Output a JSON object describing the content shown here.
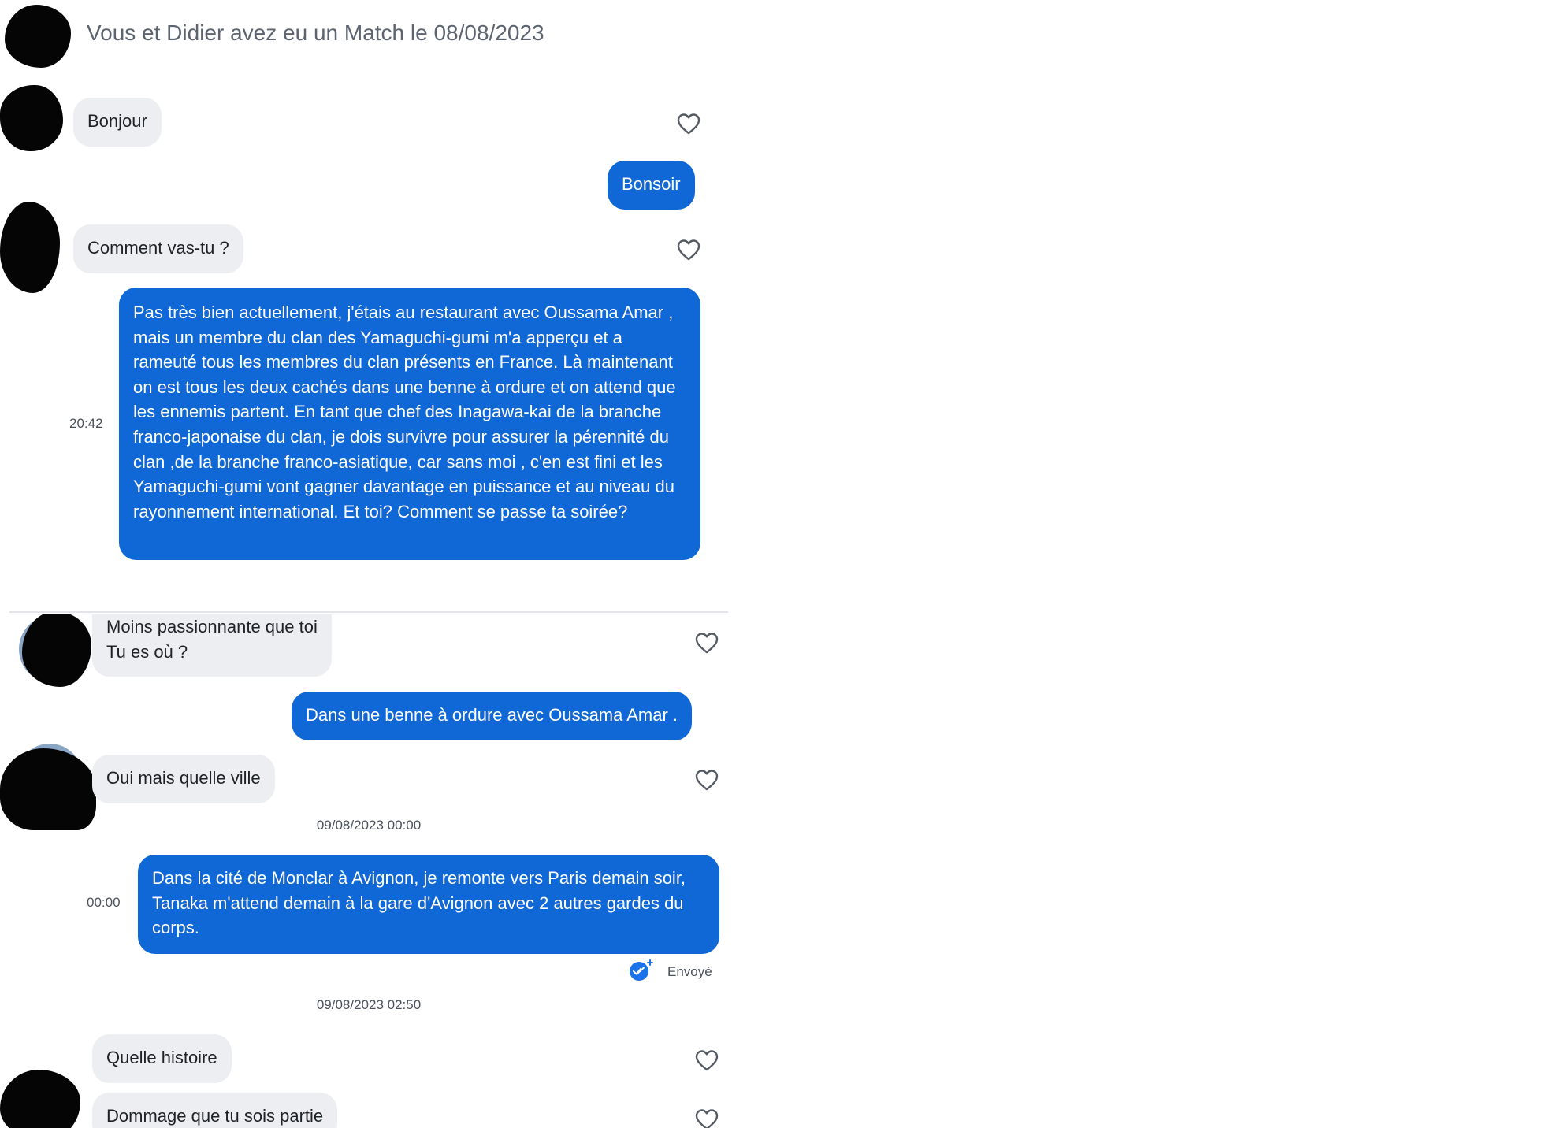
{
  "conversation": {
    "match_banner": "Vous et Didier avez eu un Match le 08/08/2023",
    "top_messages": [
      {
        "sender": "them",
        "text": "Bonjour"
      },
      {
        "sender": "me",
        "text": "Bonsoir"
      },
      {
        "sender": "them",
        "text": "Comment vas-tu ?"
      },
      {
        "sender": "me",
        "time": "20:42",
        "text": "Pas très bien actuellement, j'étais au restaurant avec Oussama Amar , mais un membre du clan des Yamaguchi-gumi m'a apperçu et a rameuté tous les membres du clan présents en France. Là maintenant on est tous les deux cachés dans une benne à ordure et on attend que les ennemis partent. En tant que  chef des Inagawa-kai de la branche franco-japonaise du clan, je dois survivre pour assurer la pérennité du clan ,de la branche franco-asiatique, car sans moi , c'en est fini et les Yamaguchi-gumi vont gagner davantage en puissance et au niveau du rayonnement international. Et toi? Comment se passe ta soirée?"
      }
    ],
    "bottom_messages": [
      {
        "sender": "them",
        "text_line1": "Moins passionnante que toi",
        "text_line2": "Tu es où ?"
      },
      {
        "sender": "me",
        "text": "Dans une benne à ordure avec Oussama Amar ."
      },
      {
        "sender": "them",
        "text": "Oui mais quelle ville"
      },
      {
        "date_separator": "09/08/2023 00:00"
      },
      {
        "sender": "me",
        "time": "00:00",
        "text": "Dans la cité de Monclar à Avignon, je remonte vers Paris demain soir, Tanaka m'attend demain à la gare d'Avignon avec 2 autres gardes du corps.",
        "status": "Envoyé"
      },
      {
        "date_separator": "09/08/2023 02:50"
      },
      {
        "sender": "them",
        "text": "Quelle histoire"
      },
      {
        "sender": "them",
        "text": "Dommage que tu sois partie"
      }
    ]
  },
  "icons": {
    "like": "heart-outline-icon",
    "sent_status": "double-check-circle-icon",
    "avatar": "avatar-redacted"
  },
  "colors": {
    "outgoing_bubble": "#1068d6",
    "incoming_bubble": "#eceef1",
    "banner_text": "#5c6470",
    "status_icon": "#1a73e8"
  }
}
